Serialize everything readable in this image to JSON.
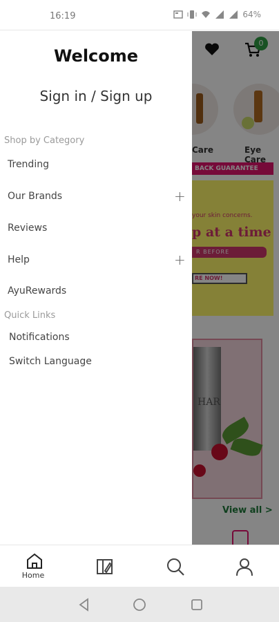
{
  "status_bar": {
    "time": "16:19",
    "battery": "64%"
  },
  "background": {
    "cart_count": "0",
    "categories": [
      "Care",
      "Eye Care"
    ],
    "banner_strip": "BACK GUARANTEE",
    "promo": {
      "subtitle": "your skin concerns.",
      "title": "p at a time",
      "brush_text": "R BEFORE",
      "button": "RE NOW!"
    },
    "product_label": "HAR",
    "view_all": "View all >"
  },
  "drawer": {
    "welcome": "Welcome",
    "sign_in": "Sign in / Sign up",
    "shop_by_category": "Shop by Category",
    "category_items": [
      {
        "label": "Trending",
        "expandable": ""
      },
      {
        "label": "Our Brands",
        "expandable": "+"
      },
      {
        "label": "Reviews",
        "expandable": ""
      },
      {
        "label": "Help",
        "expandable": "+"
      },
      {
        "label": "AyuRewards",
        "expandable": ""
      }
    ],
    "quick_links": "Quick Links",
    "quick_link_items": [
      "Notifications",
      "Switch Language"
    ]
  },
  "bottom_nav": {
    "home_label": "Home",
    "icons": [
      "home-icon",
      "catalog-icon",
      "search-icon",
      "account-icon"
    ]
  },
  "colors": {
    "accent_pink": "#e3156d",
    "badge_green": "#2e9e44",
    "view_all_green": "#1d7a3a"
  }
}
